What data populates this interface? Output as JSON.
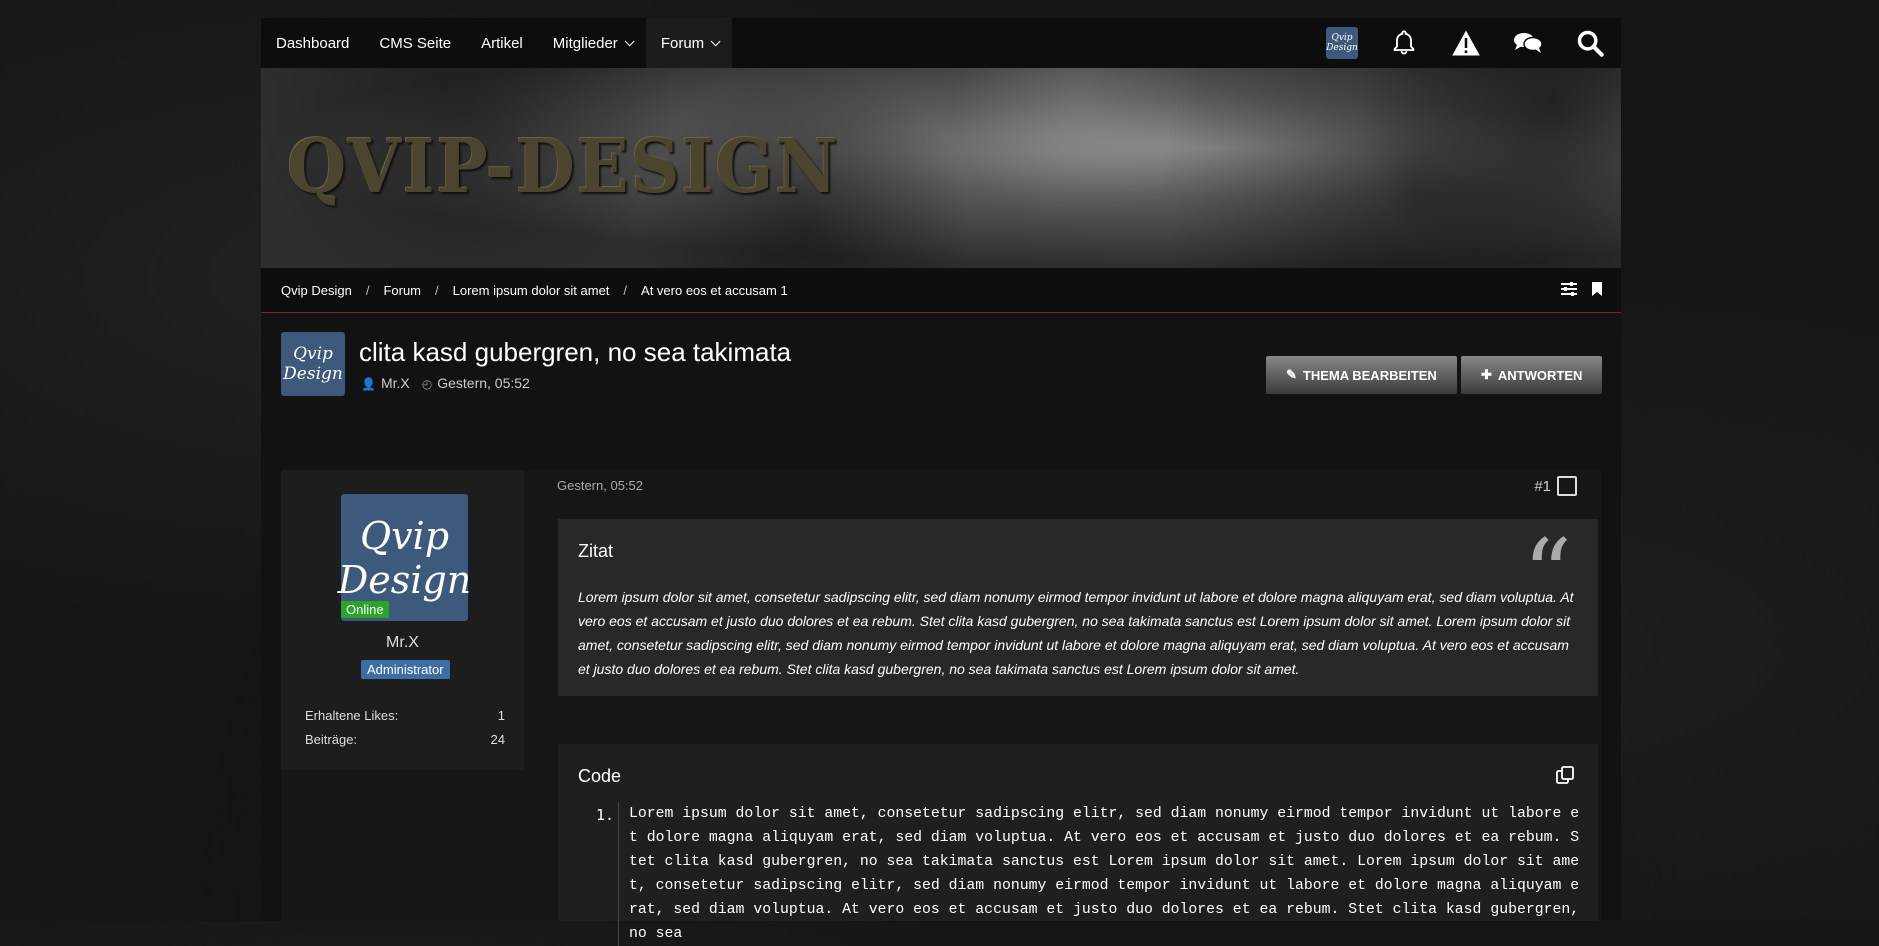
{
  "nav": {
    "items": [
      {
        "label": "Dashboard"
      },
      {
        "label": "CMS Seite"
      },
      {
        "label": "Artikel"
      },
      {
        "label": "Mitglieder"
      },
      {
        "label": "Forum"
      }
    ],
    "logo_text_1": "Qvip",
    "logo_text_2": "Design",
    "icons": [
      "bell-icon",
      "warning-icon",
      "chat-icon",
      "search-icon"
    ]
  },
  "banner": {
    "title": "QVIP-DESIGN"
  },
  "breadcrumb": {
    "items": [
      "Qvip Design",
      "Forum",
      "Lorem ipsum dolor sit amet",
      "At vero eos et accusam 1"
    ],
    "separator": "/"
  },
  "thread": {
    "title": "clita kasd gubergren, no sea takimata",
    "author": "Mr.X",
    "date": "Gestern, 05:52",
    "edit_button": "THEMA BEARBEITEN",
    "reply_button": "ANTWORTEN"
  },
  "post": {
    "date": "Gestern, 05:52",
    "number": "#1",
    "user": {
      "name": "Mr.X",
      "status": "Online",
      "rank": "Administrator",
      "avatar_text_1": "Qvip",
      "avatar_text_2": "Design",
      "likes_label": "Erhaltene Likes:",
      "likes_value": "1",
      "posts_label": "Beiträge:",
      "posts_value": "24"
    },
    "quote": {
      "title": "Zitat",
      "text": "Lorem ipsum dolor sit amet, consetetur sadipscing elitr, sed diam nonumy eirmod tempor invidunt ut labore et dolore magna aliquyam erat, sed diam voluptua. At vero eos et accusam et justo duo dolores et ea rebum. Stet clita kasd gubergren, no sea takimata sanctus est Lorem ipsum dolor sit amet. Lorem ipsum dolor sit amet, consetetur sadipscing elitr, sed diam nonumy eirmod tempor invidunt ut labore et dolore magna aliquyam erat, sed diam voluptua. At vero eos et accusam et justo duo dolores et ea rebum. Stet clita kasd gubergren, no sea takimata sanctus est Lorem ipsum dolor sit amet."
    },
    "code": {
      "title": "Code",
      "line_number": "1.",
      "text": "Lorem ipsum dolor sit amet, consetetur sadipscing elitr, sed diam nonumy eirmod tempor invidunt ut labore et dolore magna aliquyam erat, sed diam voluptua. At vero eos et accusam et justo duo dolores et ea rebum. Stet clita kasd gubergren, no sea takimata sanctus est Lorem ipsum dolor sit amet. Lorem ipsum dolor sit amet, consetetur sadipscing elitr, sed diam nonumy eirmod tempor invidunt ut labore et dolore magna aliquyam erat, sed diam voluptua. At vero eos et accusam et justo duo dolores et ea rebum. Stet clita kasd gubergren, no sea"
    }
  }
}
